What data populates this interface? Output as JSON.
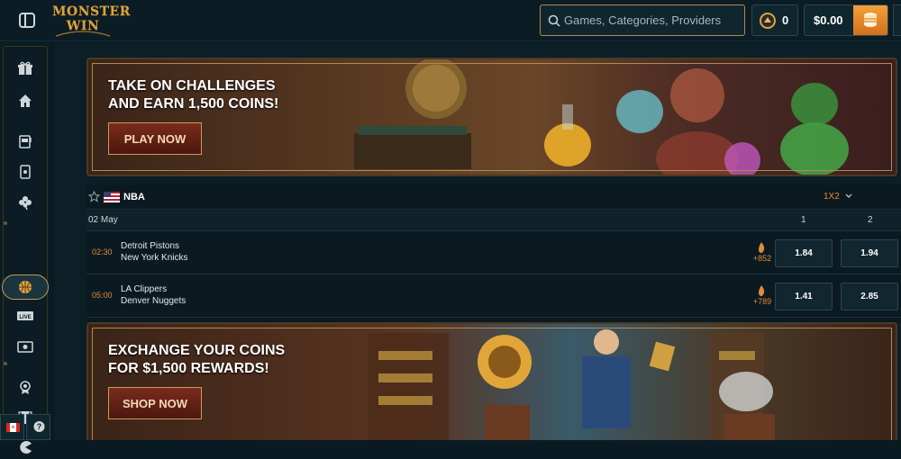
{
  "header": {
    "logo_text": "MONSTER WIN",
    "search_placeholder": "Games, Categories, Providers",
    "coins": "0",
    "balance": "$0.00"
  },
  "colors": {
    "accent": "#c79a52",
    "odds_orange": "#e08a3a",
    "wallet": "#e58a2a"
  },
  "sidebar": {
    "items": [
      "gift-icon",
      "home-icon",
      "slot-machine-icon",
      "cards-icon",
      "clover-icon",
      "basketball-icon",
      "live-icon",
      "video-poker-icon",
      "badge-icon",
      "trophy-icon",
      "pacman-icon"
    ],
    "active": "basketball-icon"
  },
  "banners": [
    {
      "title_line1": "TAKE ON CHALLENGES",
      "title_line2": "AND EARN 1,500 COINS!",
      "button": "PLAY NOW"
    },
    {
      "title_line1": "EXCHANGE YOUR COINS",
      "title_line2": "FOR $1,500 REWARDS!",
      "button": "SHOP NOW"
    }
  ],
  "sports": {
    "league": "NBA",
    "market": "1X2",
    "date": "02 May",
    "col1": "1",
    "col2": "2",
    "matches": [
      {
        "time": "02:30",
        "home": "Detroit Pistons",
        "away": "New York Knicks",
        "hot": "+852",
        "odd1": "1.84",
        "odd2": "1.94"
      },
      {
        "time": "05:00",
        "home": "LA Clippers",
        "away": "Denver Nuggets",
        "hot": "+789",
        "odd1": "1.41",
        "odd2": "2.85"
      }
    ]
  }
}
